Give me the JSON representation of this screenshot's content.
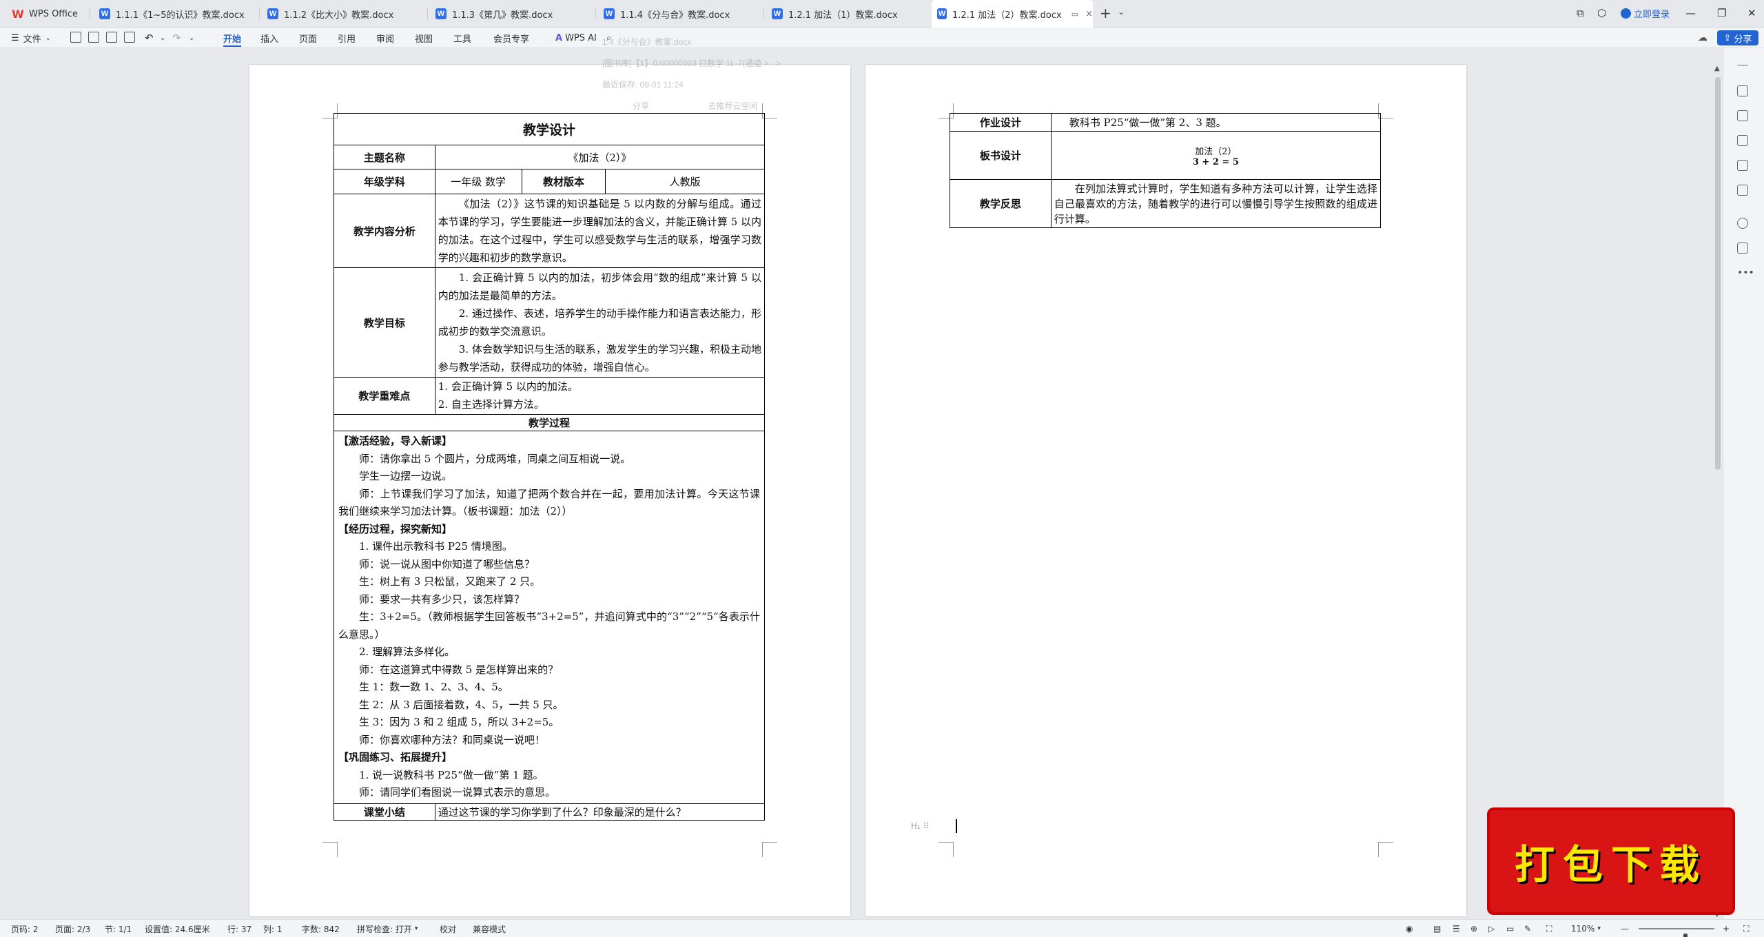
{
  "tabs": [
    {
      "label": "WPS Office",
      "kind": "home"
    },
    {
      "label": "1.1.1《1~5的认识》教案.docx"
    },
    {
      "label": "1.1.2《比大小》教案.docx"
    },
    {
      "label": "1.1.3《第几》教案.docx"
    },
    {
      "label": "1.1.4《分与合》教案.docx"
    },
    {
      "label": "1.2.1 加法（1）教案.docx"
    },
    {
      "label": "1.2.1 加法（2）教案.docx",
      "active": true
    }
  ],
  "titlebar": {
    "login": "立即登录",
    "share": "分享"
  },
  "ribbon": {
    "file": "文件",
    "menus": [
      "开始",
      "插入",
      "页面",
      "引用",
      "审阅",
      "视图",
      "工具",
      "会员专享"
    ],
    "wps_ai": "WPS AI"
  },
  "ghost": {
    "title": "1.4《分与合》教案.docx",
    "path": "[图书库]【1】0.00000003 扫数学 1L-7(通道 >...>",
    "saved": "最近保存: 09-01 11:24",
    "share": "分享",
    "open": "去推荐云空间"
  },
  "page1": {
    "header": "教学设计",
    "topic_label": "主题名称",
    "topic": "《加法（2）》",
    "grade_label": "年级学科",
    "grade": "一年级  数学",
    "edition_label": "教材版本",
    "edition": "人教版",
    "analysis_label": "教学内容分析",
    "analysis": "《加法（2）》这节课的知识基础是 5 以内数的分解与组成。通过本节课的学习，学生要能进一步理解加法的含义，并能正确计算 5 以内的加法。在这个过程中，学生可以感受数学与生活的联系，增强学习数学的兴趣和初步的数学意识。",
    "goal_label": "教学目标",
    "goals": [
      "1. 会正确计算 5 以内的加法，初步体会用“数的组成”来计算 5 以内的加法是最简单的方法。",
      "2. 通过操作、表述，培养学生的动手操作能力和语言表达能力，形成初步的数学交流意识。",
      "3. 体会数学知识与生活的联系，激发学生的学习兴趣，积极主动地参与教学活动，获得成功的体验，增强自信心。"
    ],
    "key_label": "教学重难点",
    "keys": [
      "1. 会正确计算 5 以内的加法。",
      "2. 自主选择计算方法。"
    ],
    "process_label": "教学过程",
    "process": [
      {
        "text": "【激活经验，导入新课】",
        "bold": true
      },
      {
        "text": "师：请你拿出 5 个圆片，分成两堆，同桌之间互相说一说。",
        "indent": true
      },
      {
        "text": "学生一边摆一边说。",
        "indent": true
      },
      {
        "text": "师：上节课我们学习了加法，知道了把两个数合并在一起，要用加法计算。今天这节课我们继续来学习加法计算。（板书课题：加法（2））",
        "indent": true,
        "wrap": true
      },
      {
        "text": "【经历过程，探究新知】",
        "bold": true
      },
      {
        "text": "1. 课件出示教科书 P25 情境图。",
        "indent": true
      },
      {
        "text": "师：说一说从图中你知道了哪些信息？",
        "indent": true
      },
      {
        "text": "生：树上有 3 只松鼠，又跑来了 2 只。",
        "indent": true
      },
      {
        "text": "师：要求一共有多少只，该怎样算？",
        "indent": true
      },
      {
        "text": "生：3+2=5。（教师根据学生回答板书“3+2=5”，并追问算式中的“3”“2”“5”各表示什么意思。）",
        "indent": true,
        "wrap": true
      },
      {
        "text": "2. 理解算法多样化。",
        "indent": true
      },
      {
        "text": "师：在这道算式中得数 5 是怎样算出来的？",
        "indent": true
      },
      {
        "text": "生 1：数一数 1、2、3、4、5。",
        "indent": true
      },
      {
        "text": "生 2：从 3 后面接着数，4、5，一共 5 只。",
        "indent": true
      },
      {
        "text": "生 3：因为 3 和 2 组成 5，所以 3+2=5。",
        "indent": true
      },
      {
        "text": "师：你喜欢哪种方法？和同桌说一说吧！",
        "indent": true
      },
      {
        "text": "【巩固练习、拓展提升】",
        "bold": true
      },
      {
        "text": "1. 说一说教科书 P25“做一做”第 1 题。",
        "indent": true
      },
      {
        "text": "师：请同学们看图说一说算式表示的意思。",
        "indent": true
      }
    ],
    "summary_label": "课堂小结",
    "summary": "通过这节课的学习你学到了什么？印象最深的是什么？"
  },
  "page2": {
    "hw_label": "作业设计",
    "hw": "教科书 P25“做一做”第 2、3 题。",
    "board_label": "板书设计",
    "board_title": "加法（2）",
    "board_eq": "3 + 2 = 5",
    "reflect_label": "教学反思",
    "reflect": "在列加法算式计算时，学生知道有多种方法可以计算，让学生选择自己最喜欢的方法，随着教学的进行可以慢慢引导学生按照数的组成进行计算。"
  },
  "status": {
    "page_num": "页码: 2",
    "pages": "页面: 2/3",
    "section": "节: 1/1",
    "setting": "设置值: 24.6厘米",
    "row": "行: 37",
    "col": "列: 1",
    "words": "字数: 842",
    "spell": "拼写检查: 打开",
    "proof": "校对",
    "compat": "兼容模式",
    "zoom": "110%"
  },
  "zoom_level": 0.62,
  "stamp": "打包下载",
  "colors": {
    "accent": "#2364d2",
    "wps_red": "#e3372f",
    "word_blue": "#2f6fed",
    "stamp_red": "#d81414",
    "stamp_text": "#ffe800"
  },
  "icons": [
    "wps-logo-icon",
    "word-doc-icon",
    "close-icon",
    "pin-icon",
    "plus-icon",
    "user-icon",
    "cloud-icon",
    "search-icon",
    "undo-icon",
    "redo-icon",
    "save-icon",
    "print-icon"
  ]
}
